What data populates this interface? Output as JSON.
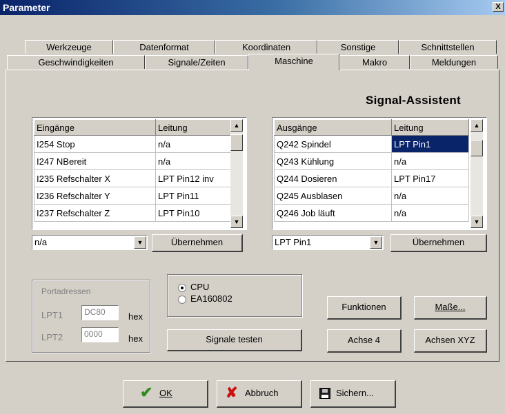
{
  "window": {
    "title": "Parameter",
    "close": "X"
  },
  "tabs_back": [
    "Werkzeuge",
    "Datenformat",
    "Koordinaten",
    "Sonstige",
    "Schnittstellen"
  ],
  "tabs_front": [
    "Geschwindigkeiten",
    "Signale/Zeiten",
    "Maschine",
    "Makro",
    "Meldungen"
  ],
  "heading": "Signal-Assistent",
  "inputs_table": {
    "headers": [
      "Eingänge",
      "Leitung"
    ],
    "rows": [
      [
        "I254 Stop",
        "n/a"
      ],
      [
        "I247 NBereit",
        "n/a"
      ],
      [
        "I235 Refschalter X",
        "LPT Pin12 inv"
      ],
      [
        "I236 Refschalter Y",
        "LPT Pin11"
      ],
      [
        "I237 Refschalter Z",
        "LPT Pin10"
      ]
    ]
  },
  "outputs_table": {
    "headers": [
      "Ausgänge",
      "Leitung"
    ],
    "rows": [
      [
        "Q242 Spindel",
        "LPT Pin1"
      ],
      [
        "Q243 Kühlung",
        "n/a"
      ],
      [
        "Q244 Dosieren",
        "LPT Pin17"
      ],
      [
        "Q245 Ausblasen",
        "n/a"
      ],
      [
        "Q246 Job läuft",
        "n/a"
      ]
    ]
  },
  "input_combo": "n/a",
  "output_combo": "LPT Pin1",
  "apply_label": "Übernehmen",
  "ports": {
    "legend": "Portadressen",
    "lpt1_label": "LPT1",
    "lpt1_value": "DC80",
    "lpt2_label": "LPT2",
    "lpt2_value": "0000",
    "unit": "hex"
  },
  "interface": {
    "option1": "CPU",
    "option2": "EA160802",
    "selected": "CPU"
  },
  "buttons": {
    "test_signals": "Signale testen",
    "functions": "Funktionen",
    "dimensions": "Maße...",
    "axis4": "Achse 4",
    "axes_xyz": "Achsen XYZ",
    "ok": "OK",
    "cancel": "Abbruch",
    "save": "Sichern..."
  },
  "colors": {
    "title_start": "#0a246a",
    "selection": "#0a246a",
    "ok_check": "#2e8b1e",
    "cancel_x": "#cc1111"
  }
}
